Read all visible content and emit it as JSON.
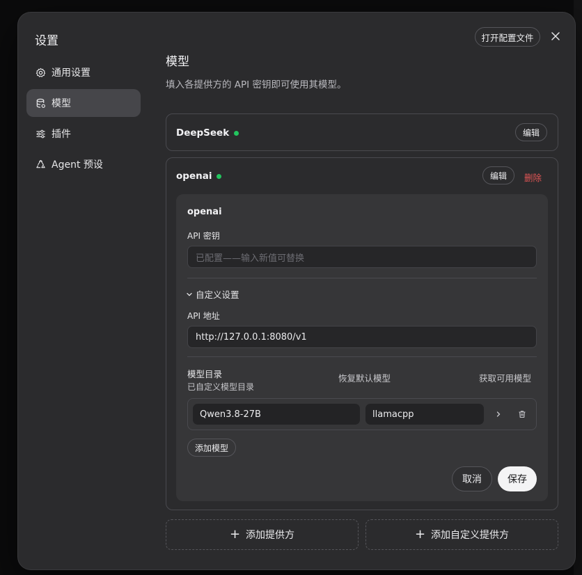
{
  "dialog": {
    "title": "设置",
    "open_config_label": "打开配置文件"
  },
  "sidebar": {
    "items": [
      {
        "label": "通用设置",
        "icon": "gear-icon"
      },
      {
        "label": "模型",
        "icon": "database-icon"
      },
      {
        "label": "插件",
        "icon": "sliders-icon"
      },
      {
        "label": "Agent 预设",
        "icon": "recycle-icon"
      }
    ],
    "active_index": 1
  },
  "main": {
    "title": "模型",
    "description": "填入各提供方的 API 密钥即可使用其模型。"
  },
  "providers": [
    {
      "name": "DeepSeek",
      "status_color": "#22c55e",
      "edit_label": "编辑"
    },
    {
      "name": "openai",
      "status_color": "#22c55e",
      "edit_label": "编辑",
      "delete_label": "删除"
    }
  ],
  "editor": {
    "title": "openai",
    "api_key_label": "API 密钥",
    "api_key_placeholder": "已配置——输入新值可替换",
    "custom_settings_label": "自定义设置",
    "api_url_label": "API 地址",
    "api_url_value": "http://127.0.0.1:8080/v1",
    "catalog_title": "模型目录",
    "catalog_subtitle": "已自定义模型目录",
    "restore_default_label": "恢复默认模型",
    "fetch_models_label": "获取可用模型",
    "models": [
      {
        "name": "Qwen3.8-27B",
        "backend": "llamacpp"
      }
    ],
    "add_model_label": "添加模型",
    "cancel_label": "取消",
    "save_label": "保存"
  },
  "footer": {
    "add_provider_label": "添加提供方",
    "add_custom_provider_label": "添加自定义提供方"
  },
  "colors": {
    "status_ok": "#22c55e",
    "danger": "#e05555",
    "dialog_bg": "#2b2b2d"
  }
}
